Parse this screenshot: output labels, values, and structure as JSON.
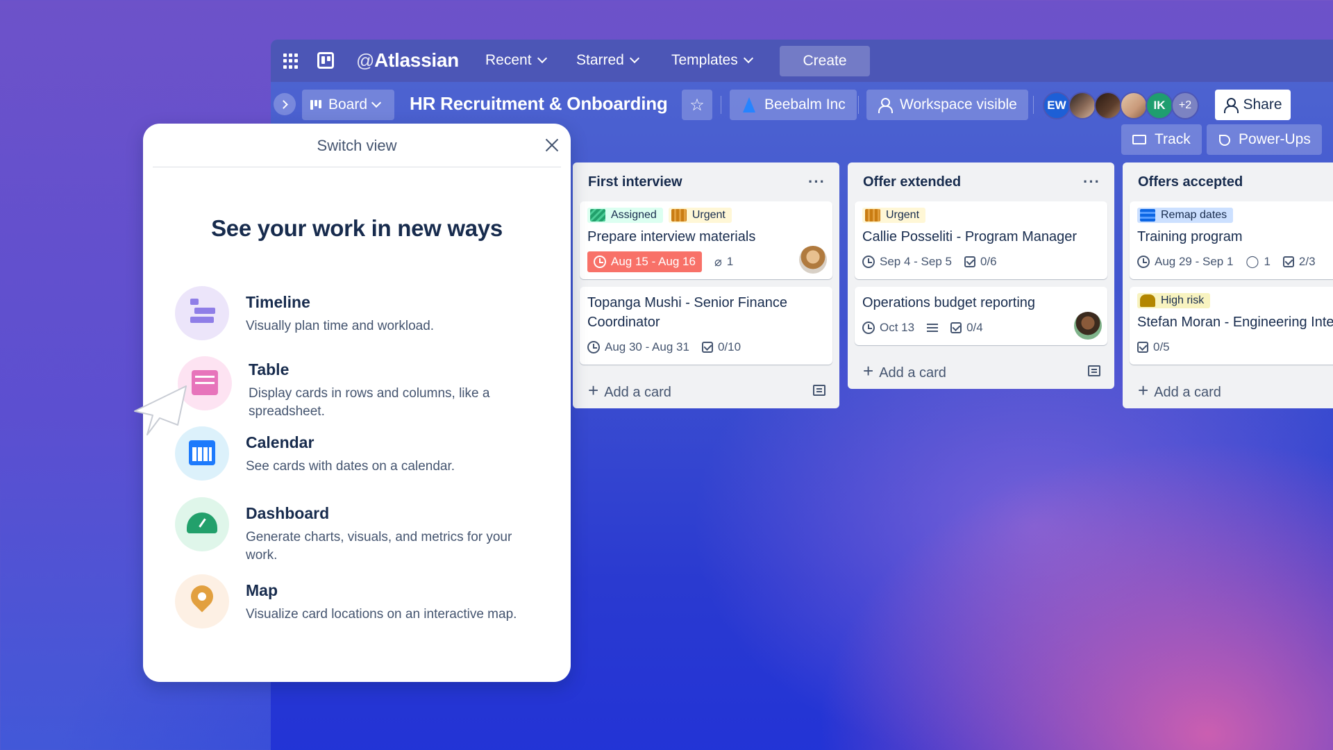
{
  "topnav": {
    "brand_at": "@",
    "brand": "Atlassian",
    "menus": [
      "Recent",
      "Starred",
      "Templates"
    ],
    "create_label": "Create"
  },
  "board_header": {
    "view_label": "Board",
    "title": "HR Recruitment & Onboarding",
    "workspace": "Beebalm Inc",
    "visibility": "Workspace visible",
    "members": [
      {
        "initials": "EW",
        "color": "#1d5fd6"
      },
      {
        "initials": "",
        "color": "#8a6a58"
      },
      {
        "initials": "",
        "color": "#5b3d2c"
      },
      {
        "initials": "",
        "color": "#c99a7a"
      },
      {
        "initials": "IK",
        "color": "#1f9e6f"
      }
    ],
    "more_members": "+2",
    "share_label": "Share",
    "track_label": "Track",
    "powerups_label": "Power-Ups"
  },
  "lists": [
    {
      "title": "First interview",
      "cards": [
        {
          "labels": [
            {
              "text": "Assigned",
              "bg": "#dcfff1",
              "swatch": "#22a06b"
            },
            {
              "text": "Urgent",
              "bg": "#fff7d6",
              "swatch": "#e2a03f"
            }
          ],
          "title": "Prepare interview materials",
          "due": "Aug 15 - Aug 16",
          "attachments": "1"
        },
        {
          "title": "Topanga Mushi - Senior Finance Coordinator",
          "dates": "Aug 30 - Aug 31",
          "checklist": "0/10"
        }
      ],
      "add_card": "Add a card"
    },
    {
      "title": "Offer extended",
      "cards": [
        {
          "labels": [
            {
              "text": "Urgent",
              "bg": "#fff7d6",
              "swatch": "#e2a03f"
            }
          ],
          "title": "Callie Posseliti - Program Manager",
          "dates": "Sep 4 - Sep 5",
          "checklist": "0/6"
        },
        {
          "title": "Operations budget reporting",
          "dates": "Oct 13",
          "checklist": "0/4"
        }
      ],
      "add_card": "Add a card"
    },
    {
      "title": "Offers accepted",
      "cards": [
        {
          "labels": [
            {
              "text": "Remap dates",
              "bg": "#cce0ff",
              "swatch": "#1d7afc"
            }
          ],
          "title": "Training program",
          "dates": "Aug 29 - Sep 1",
          "comments": "1",
          "checklist": "2/3"
        },
        {
          "labels": [
            {
              "text": "High risk",
              "bg": "#f8f3c0",
              "swatch": "#b38600"
            }
          ],
          "title": "Stefan Moran - Engineering Intern",
          "checklist": "0/5"
        }
      ],
      "add_card": "Add a card"
    }
  ],
  "switch_view": {
    "header": "Switch view",
    "heading": "See your work in new ways",
    "views": [
      {
        "name": "Timeline",
        "desc": "Visually plan time and workload.",
        "icon": "timeline-icon",
        "color": "#ece5fa"
      },
      {
        "name": "Table",
        "desc": "Display cards in rows and columns, like a spreadsheet.",
        "icon": "table-icon",
        "color": "#fde3f2"
      },
      {
        "name": "Calendar",
        "desc": "See cards with dates on a calendar.",
        "icon": "calendar-icon",
        "color": "#dcf1fb"
      },
      {
        "name": "Dashboard",
        "desc": "Generate charts, visuals, and metrics for your work.",
        "icon": "dashboard-icon",
        "color": "#dff6ea"
      },
      {
        "name": "Map",
        "desc": "Visualize card locations on an interactive map.",
        "icon": "map-icon",
        "color": "#fdf0e4"
      }
    ]
  }
}
